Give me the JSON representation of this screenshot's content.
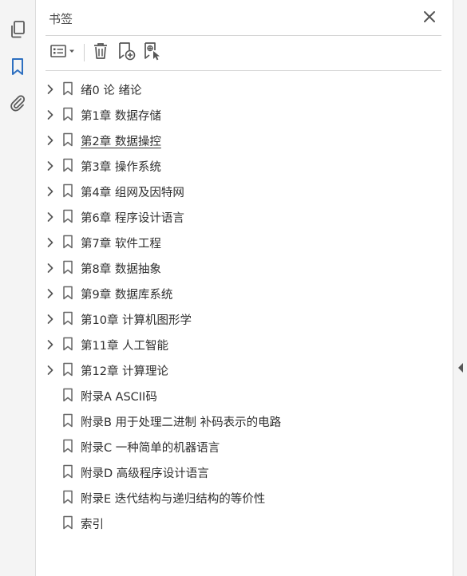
{
  "panel": {
    "title": "书签"
  },
  "left_rail": {
    "icons": [
      "pages-icon",
      "bookmark-icon",
      "attachment-icon"
    ],
    "active": "bookmark-icon",
    "accent_color": "#2d6fc0"
  },
  "toolbar": {
    "buttons": [
      "options-menu-icon",
      "delete-icon",
      "new-bookmark-icon",
      "new-bookmark-from-selection-icon"
    ]
  },
  "bookmarks": [
    {
      "label": "绪0 论 绪论",
      "expandable": true,
      "hovered": false
    },
    {
      "label": "第1章 数据存储",
      "expandable": true,
      "hovered": false
    },
    {
      "label": "第2章 数据操控",
      "expandable": true,
      "hovered": true
    },
    {
      "label": "第3章 操作系统",
      "expandable": true,
      "hovered": false
    },
    {
      "label": "第4章 组网及因特网",
      "expandable": true,
      "hovered": false
    },
    {
      "label": "第6章 程序设计语言",
      "expandable": true,
      "hovered": false
    },
    {
      "label": "第7章 软件工程",
      "expandable": true,
      "hovered": false
    },
    {
      "label": "第8章 数据抽象",
      "expandable": true,
      "hovered": false
    },
    {
      "label": "第9章 数据库系统",
      "expandable": true,
      "hovered": false
    },
    {
      "label": "第10章 计算机图形学",
      "expandable": true,
      "hovered": false
    },
    {
      "label": "第11章 人工智能",
      "expandable": true,
      "hovered": false
    },
    {
      "label": "第12章 计算理论",
      "expandable": true,
      "hovered": false
    },
    {
      "label": "附录A ASCII码",
      "expandable": false,
      "hovered": false
    },
    {
      "label": "附录B 用于处理二进制 补码表示的电路",
      "expandable": false,
      "hovered": false
    },
    {
      "label": "附录C 一种简单的机器语言",
      "expandable": false,
      "hovered": false
    },
    {
      "label": "附录D 高级程序设计语言",
      "expandable": false,
      "hovered": false
    },
    {
      "label": "附录E 迭代结构与递归结构的等价性",
      "expandable": false,
      "hovered": false
    },
    {
      "label": "索引",
      "expandable": false,
      "hovered": false
    }
  ]
}
